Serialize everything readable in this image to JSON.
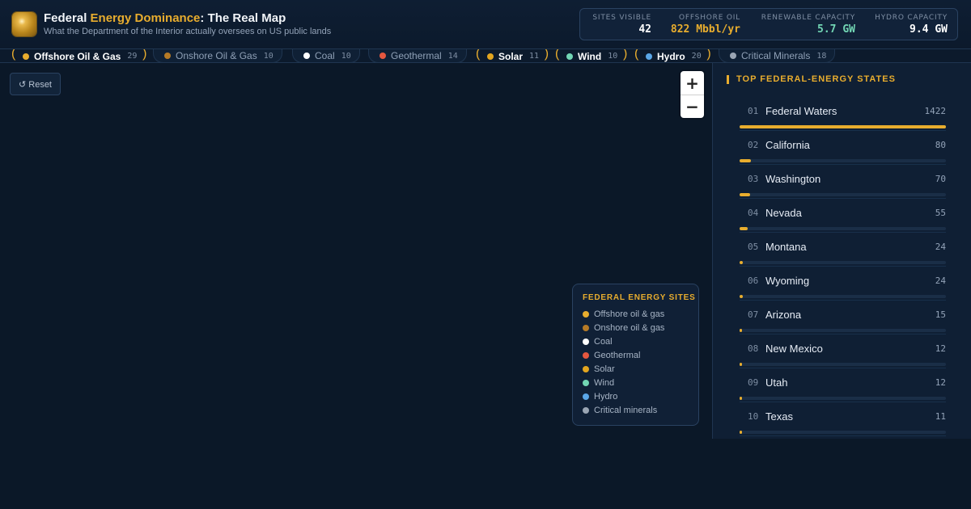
{
  "header": {
    "title_part1": "Federal ",
    "title_accent": "Energy Dominance",
    "title_part2": ": The Real Map",
    "subtitle": "What the Department of the Interior actually oversees on US public lands",
    "logo_icon": "gold-orb-icon"
  },
  "stats": [
    {
      "label": "SITES VISIBLE",
      "value": "42",
      "color": "#ffffff"
    },
    {
      "label": "OFFSHORE OIL",
      "value": "822 Mbbl/yr",
      "color": "#e8ad2e"
    },
    {
      "label": "RENEWABLE CAPACITY",
      "value": "5.7 GW",
      "color": "#72d6b4"
    },
    {
      "label": "HYDRO CAPACITY",
      "value": "9.4 GW",
      "color": "#ffffff"
    }
  ],
  "filters": [
    {
      "label": "Offshore Oil & Gas",
      "count": "29",
      "color": "#e8ad2e",
      "active": true
    },
    {
      "label": "Onshore Oil & Gas",
      "count": "10",
      "color": "#b57a26",
      "active": false
    },
    {
      "label": "Coal",
      "count": "10",
      "color": "#ffffff",
      "active": false
    },
    {
      "label": "Geothermal",
      "count": "14",
      "color": "#e5573f",
      "active": false
    },
    {
      "label": "Solar",
      "count": "11",
      "color": "#e3a51f",
      "active": true
    },
    {
      "label": "Wind",
      "count": "10",
      "color": "#72d6b4",
      "active": true
    },
    {
      "label": "Hydro",
      "count": "20",
      "color": "#5aa7e8",
      "active": true
    },
    {
      "label": "Critical Minerals",
      "count": "18",
      "color": "#9aa5b3",
      "active": false
    }
  ],
  "map": {
    "reset_label": "↺ Reset",
    "zoom_in_label": "+",
    "zoom_out_label": "−"
  },
  "legend": {
    "title": "FEDERAL ENERGY SITES",
    "items": [
      {
        "label": "Offshore oil & gas",
        "color": "#e8ad2e"
      },
      {
        "label": "Onshore oil & gas",
        "color": "#b57a26"
      },
      {
        "label": "Coal",
        "color": "#ffffff"
      },
      {
        "label": "Geothermal",
        "color": "#e5573f"
      },
      {
        "label": "Solar",
        "color": "#e3a51f"
      },
      {
        "label": "Wind",
        "color": "#72d6b4"
      },
      {
        "label": "Hydro",
        "color": "#5aa7e8"
      },
      {
        "label": "Critical minerals",
        "color": "#9aa5b3"
      }
    ]
  },
  "panel": {
    "title": "TOP FEDERAL-ENERGY STATES",
    "max_value": 1422,
    "states": [
      {
        "rank": "01",
        "name": "Federal Waters",
        "value": 1422
      },
      {
        "rank": "02",
        "name": "California",
        "value": 80
      },
      {
        "rank": "03",
        "name": "Washington",
        "value": 70
      },
      {
        "rank": "04",
        "name": "Nevada",
        "value": 55
      },
      {
        "rank": "05",
        "name": "Montana",
        "value": 24
      },
      {
        "rank": "06",
        "name": "Wyoming",
        "value": 24
      },
      {
        "rank": "07",
        "name": "Arizona",
        "value": 15
      },
      {
        "rank": "08",
        "name": "New Mexico",
        "value": 12
      },
      {
        "rank": "09",
        "name": "Utah",
        "value": 12
      },
      {
        "rank": "10",
        "name": "Texas",
        "value": 11
      }
    ]
  }
}
